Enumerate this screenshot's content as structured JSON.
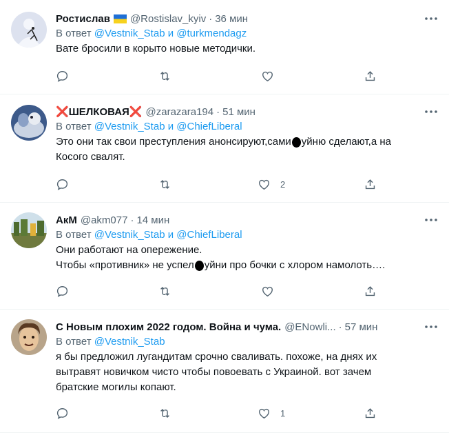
{
  "colors": {
    "link": "#1d9bf0",
    "muted": "#536471",
    "text": "#0f1419",
    "divider": "#eff3f4"
  },
  "tweets": [
    {
      "name": "Ростислав",
      "flag": "ukraine-flag",
      "handle": "@Rostislav_kyiv",
      "dot": "·",
      "time": "36 мин",
      "reply_prefix": "В ответ",
      "mention1": "@Vestnik_Stab",
      "reply_and": "и",
      "mention2": "@turkmendagz",
      "text_lines": [
        "Вате бросили в корыто новые методички."
      ],
      "like_count": ""
    },
    {
      "name": "ШЕЛКОВАЯ",
      "name_prefix": "❌",
      "name_suffix": "❌",
      "handle": "@zarazara194",
      "dot": "·",
      "time": "51 мин",
      "reply_prefix": "В ответ",
      "mention1": "@Vestnik_Stab",
      "reply_and": "и",
      "mention2": "@ChiefLiberal",
      "text_line1_a": "Это они так свои преступления анонсируют,сами",
      "text_line1_b": "уйню сделают,а на",
      "text_line2": "Косого свалят.",
      "like_count": "2"
    },
    {
      "name": "АкМ",
      "handle": "@akm077",
      "dot": "·",
      "time": "14 мин",
      "reply_prefix": "В ответ",
      "mention1": "@Vestnik_Stab",
      "reply_and": "и",
      "mention2": "@ChiefLiberal",
      "text_line1": "Они работают на опережение.",
      "text_line2_a": "Чтобы «противник» не успел",
      "text_line2_b": "уйни про бочки с хлором намолоть….",
      "like_count": ""
    },
    {
      "name": "С Новым плохим 2022 годом. Война и чума.",
      "handle": "@ENowli...",
      "dot": "·",
      "time": "57 мин",
      "reply_prefix": "В ответ",
      "mention1": "@Vestnik_Stab",
      "text_lines": [
        "я бы предложил лугандитам срочно сваливать. похоже, на днях их",
        "вытравят новичком чисто чтобы повоевать с Украиной. вот зачем",
        "братские могилы копают."
      ],
      "like_count": "1"
    }
  ],
  "icons": [
    "more-icon",
    "reply-icon",
    "retweet-icon",
    "like-icon",
    "share-icon"
  ]
}
